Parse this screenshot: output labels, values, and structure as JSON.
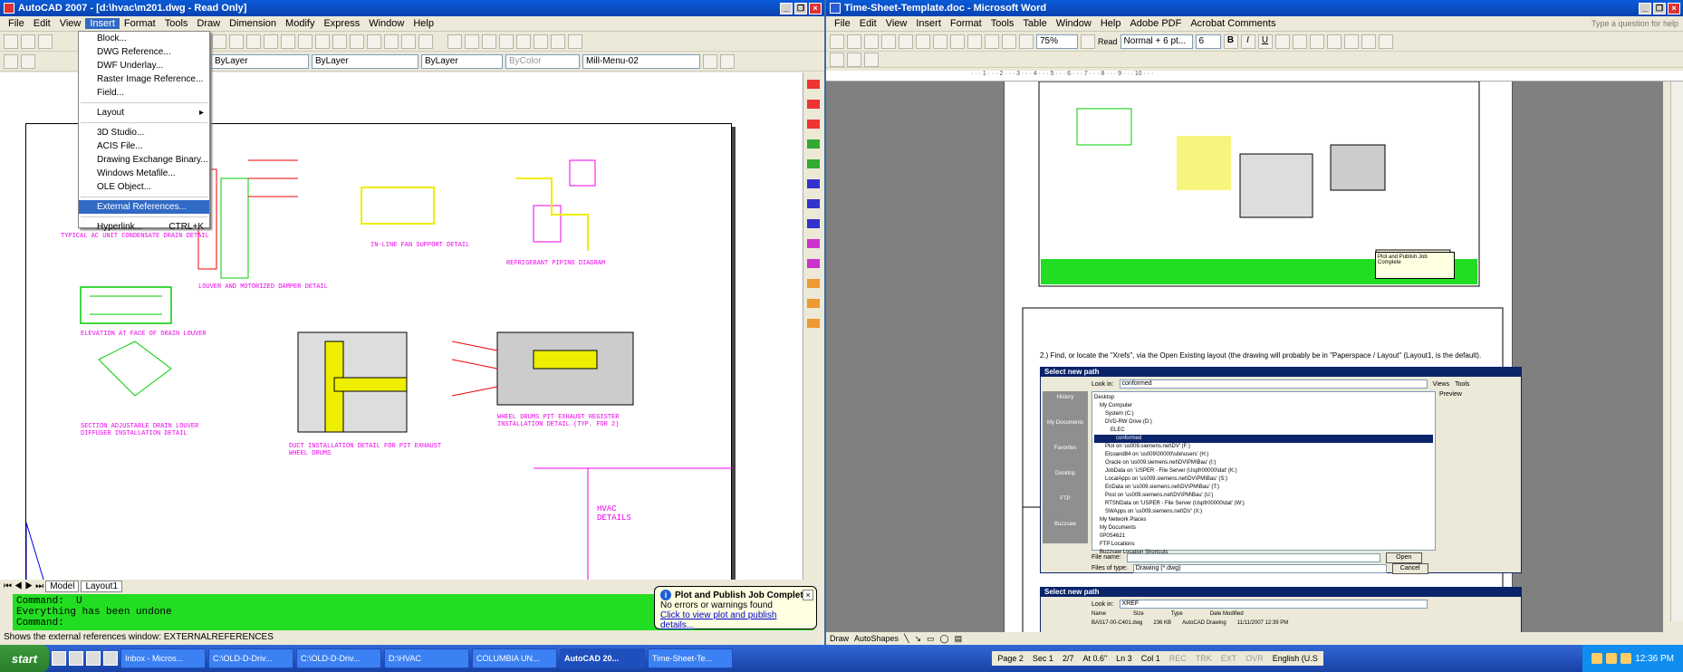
{
  "acad": {
    "title": "AutoCAD 2007 - [d:\\hvac\\m201.dwg - Read Only]",
    "menu": [
      "File",
      "Edit",
      "View",
      "Insert",
      "Format",
      "Tools",
      "Draw",
      "Dimension",
      "Modify",
      "Express",
      "Window",
      "Help"
    ],
    "layer_combo": "ByLayer",
    "linetype_combo": "ByLayer",
    "lineweight_combo": "ByLayer",
    "color_combo": "ByColor",
    "plotstyle_combo": "Mill-Menu-02",
    "insert_menu": [
      {
        "label": "Block...",
        "shortcut": ""
      },
      {
        "label": "DWG Reference...",
        "shortcut": ""
      },
      {
        "label": "DWF Underlay...",
        "shortcut": ""
      },
      {
        "label": "Raster Image Reference...",
        "shortcut": ""
      },
      {
        "label": "Field...",
        "shortcut": ""
      },
      {
        "label": "Layout",
        "shortcut": "▸"
      },
      {
        "label": "3D Studio...",
        "shortcut": ""
      },
      {
        "label": "ACIS File...",
        "shortcut": ""
      },
      {
        "label": "Drawing Exchange Binary...",
        "shortcut": ""
      },
      {
        "label": "Windows Metafile...",
        "shortcut": ""
      },
      {
        "label": "OLE Object...",
        "shortcut": ""
      },
      {
        "label": "External References...",
        "shortcut": ""
      },
      {
        "label": "Hyperlink...",
        "shortcut": "CTRL+K"
      }
    ],
    "drawing_labels": [
      "TYPICAL AC UNIT CONDENSATE DRAIN DETAIL",
      "LOUVER AND MOTORIZED DAMPER DETAIL",
      "IN-LINE FAN SUPPORT DETAIL",
      "REFRIGERANT PIPING DIAGRAM",
      "ELEVATION AT FACE OF DRAIN LOUVER",
      "DUCT INSTALLATION DETAIL FOR PIT EXHAUST WHEEL DRUMS",
      "WHEEL DRUMS PIT EXHAUST REGISTER INSTALLATION DETAIL (TYP. FOR 2)",
      "SECTION ADJUSTABLE DRAIN LOUVER DIFFUSER INSTALLATION DETAIL",
      "HVAC DETAILS"
    ],
    "tabs": [
      "Model",
      "Layout1"
    ],
    "command_lines": [
      "Command:  U",
      "Everything has been undone",
      "Command:"
    ],
    "status_text": "Shows the external references window:  EXTERNALREFERENCES",
    "balloon": {
      "title": "Plot and Publish Job Complete",
      "line1": "No errors or warnings found",
      "link": "Click to view plot and publish details..."
    }
  },
  "word": {
    "title": "Time-Sheet-Template.doc - Microsoft Word",
    "menu": [
      "File",
      "Edit",
      "View",
      "Insert",
      "Format",
      "Tools",
      "Table",
      "Window",
      "Help",
      "Adobe PDF",
      "Acrobat Comments"
    ],
    "help_placeholder": "Type a question for help",
    "zoom": "75%",
    "read_label": "Read",
    "style": "Normal + 6 pt...",
    "font_size": "6",
    "body_text": "2.) Find, or locate the  \"Xrefs\", via the  Open Existing  layout (the drawing will probably be in \"Paperspace / Layout\" (Layout1, is the default).",
    "dialog1": {
      "title": "Select new path",
      "look_in_label": "Look in:",
      "look_in": "conformed",
      "places": [
        "History",
        "My Documents",
        "Favorites",
        "Desktop",
        "FTP",
        "Buzzsaw"
      ],
      "tree": [
        "Desktop",
        "My Computer",
        "System (C:)",
        "DVD-RW Drive (D:)",
        "ELEC",
        "conformed",
        "Plot on 'us009.siemens.net\\DV' (F:)",
        "Elcoand84 on 'us009\\00000\\site\\users' (H:)",
        "Oracle on 'us009.siemens.net\\DV\\PM\\Bau' (I:)",
        "JobData on 'USPER - File Server (Uspfr00000\\dat' (K:)",
        "LocalApps on 'us009.siemens.net\\DV\\PM\\Bau' (S:)",
        "EnData on 'us009.siemens.net\\DV\\PM\\Bau' (T:)",
        "Post on 'us009.siemens.net\\DV\\PM\\Bau' (U:)",
        "RTSNData on 'USPER - File Server (Uspfr00000\\dat' (W:)",
        "SWApps on 'us009.siemens.net\\DV' (X:)",
        "My Network Places",
        "My Documents",
        "0P0S4621",
        "FTP Locations",
        "Buzzsaw Location Shortcuts"
      ],
      "views_label": "Views",
      "tools_label": "Tools",
      "preview_label": "Preview",
      "file_name_label": "File name:",
      "file_type_label": "Files of type:",
      "file_type": "Drawing (*.dwg)",
      "open_btn": "Open",
      "cancel_btn": "Cancel"
    },
    "dialog2": {
      "title": "Select new path",
      "look_in": "XREF",
      "columns": [
        "Name",
        "Size",
        "Type",
        "Date Modified"
      ],
      "row": [
        "BAS17-00-C401.dwg",
        "236 KB",
        "AutoCAD Drawing",
        "11/11/2007 12:39 PM"
      ]
    },
    "notif_title": "Plot and Publish Job Complete",
    "draw_label": "Draw",
    "autoshapes_label": "AutoShapes",
    "status": [
      "Page 2",
      "Sec 1",
      "2/7",
      "At 0.6\"",
      "Ln 3",
      "Col 1",
      "REC",
      "TRK",
      "EXT",
      "OVR",
      "English (U.S"
    ]
  },
  "taskbar": {
    "start": "start",
    "tasks": [
      "Inbox - Micros...",
      "C:\\OLD-D-Driv...",
      "C:\\OLD-D-Driv...",
      "D:\\HVAC",
      "COLUMBIA UN...",
      "AutoCAD 20...",
      "Time-Sheet-Te..."
    ],
    "clock": "12:36 PM"
  }
}
